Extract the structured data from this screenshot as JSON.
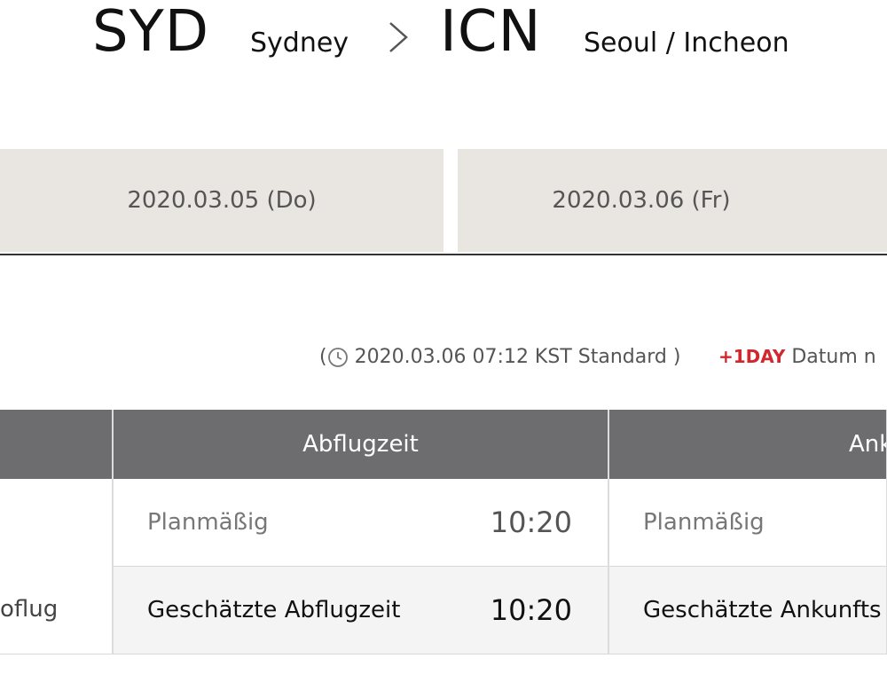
{
  "route": {
    "origin_code": "SYD",
    "origin_city": "Sydney",
    "destination_code": "ICN",
    "destination_city": "Seoul / Incheon"
  },
  "date_tabs": [
    {
      "label": "2020.03.05 (Do)"
    },
    {
      "label": "2020.03.06 (Fr)"
    }
  ],
  "reference": {
    "open_paren": "(",
    "datetime": " 2020.03.06 07:12 KST Standard )",
    "next_day_badge": "+1DAY",
    "next_day_text": "Datum n",
    "badge_color": "#d0282e"
  },
  "table": {
    "headers": {
      "col1": "",
      "departure": "Abflugzeit",
      "arrival": "Ank"
    },
    "row_group_label": "oflug",
    "rows": {
      "planned": {
        "departure_label": "Planmäßig",
        "departure_time": "10:20",
        "arrival_label": "Planmäßig"
      },
      "estimated": {
        "departure_label": "Geschätzte Abflugzeit",
        "departure_time": "10:20",
        "arrival_label": "Geschätzte Ankunfts"
      }
    }
  },
  "icons": {
    "route_arrow": "chevron-right-icon",
    "clock": "clock-icon"
  }
}
